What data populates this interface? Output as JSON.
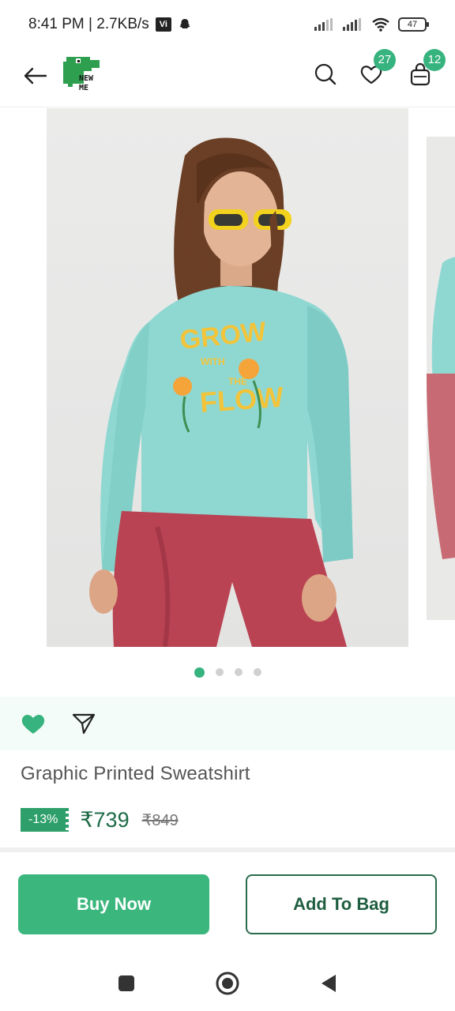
{
  "status_bar": {
    "time_speed": "8:41 PM | 2.7KB/s",
    "carrier_badge": "Vi",
    "battery": "47"
  },
  "header": {
    "logo_text_line1": "NEW",
    "logo_text_line2": "ME",
    "wishlist_count": "27",
    "bag_count": "12",
    "icons": [
      "back-arrow-icon",
      "search-icon",
      "heart-icon",
      "shopping-bag-icon"
    ]
  },
  "carousel": {
    "current": 1,
    "total": 4,
    "graphic_text": [
      "GROW",
      "WITH",
      "THE",
      "FLOW"
    ]
  },
  "product": {
    "title": "Graphic Printed Sweatshirt",
    "discount": "-13%",
    "price": "₹739",
    "mrp": "₹849"
  },
  "actions": {
    "buy_now": "Buy Now",
    "add_to_bag": "Add To Bag"
  },
  "colors": {
    "accent": "#36b37e",
    "dark_green": "#1f5e40",
    "strip_bg": "#f3fcf8"
  }
}
